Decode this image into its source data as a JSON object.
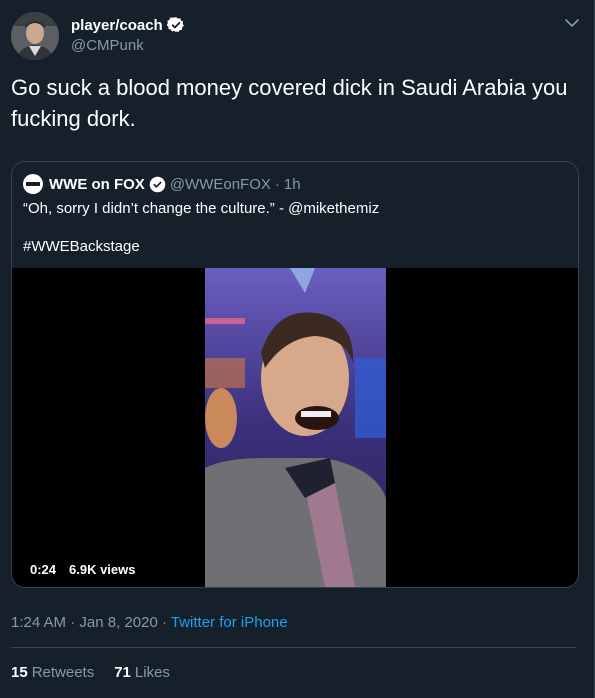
{
  "author": {
    "display_name": "player/coach",
    "handle": "@CMPunk",
    "verified": true,
    "avatar_icon": "user-avatar"
  },
  "tweet_text": "Go suck a blood money covered dick in Saudi Arabia you fucking dork.",
  "quoted_tweet": {
    "display_name": "WWE on FOX",
    "handle": "@WWEonFOX",
    "separator": "·",
    "time_ago": "1h",
    "text": "“Oh, sorry I didn’t change the culture.” - @mikethemiz",
    "hashtag": "#WWEBackstage",
    "video": {
      "duration": "0:24",
      "views": "6.9K views"
    }
  },
  "meta": {
    "time": "1:24 AM",
    "date": "Jan 8, 2020",
    "source": "Twitter for iPhone"
  },
  "stats": {
    "retweets_count": "15",
    "retweets_label": "Retweets",
    "likes_count": "71",
    "likes_label": "Likes"
  },
  "colors": {
    "background": "#15202b",
    "border": "#38444d",
    "secondary_text": "#8899a6",
    "link": "#1da1f2"
  }
}
